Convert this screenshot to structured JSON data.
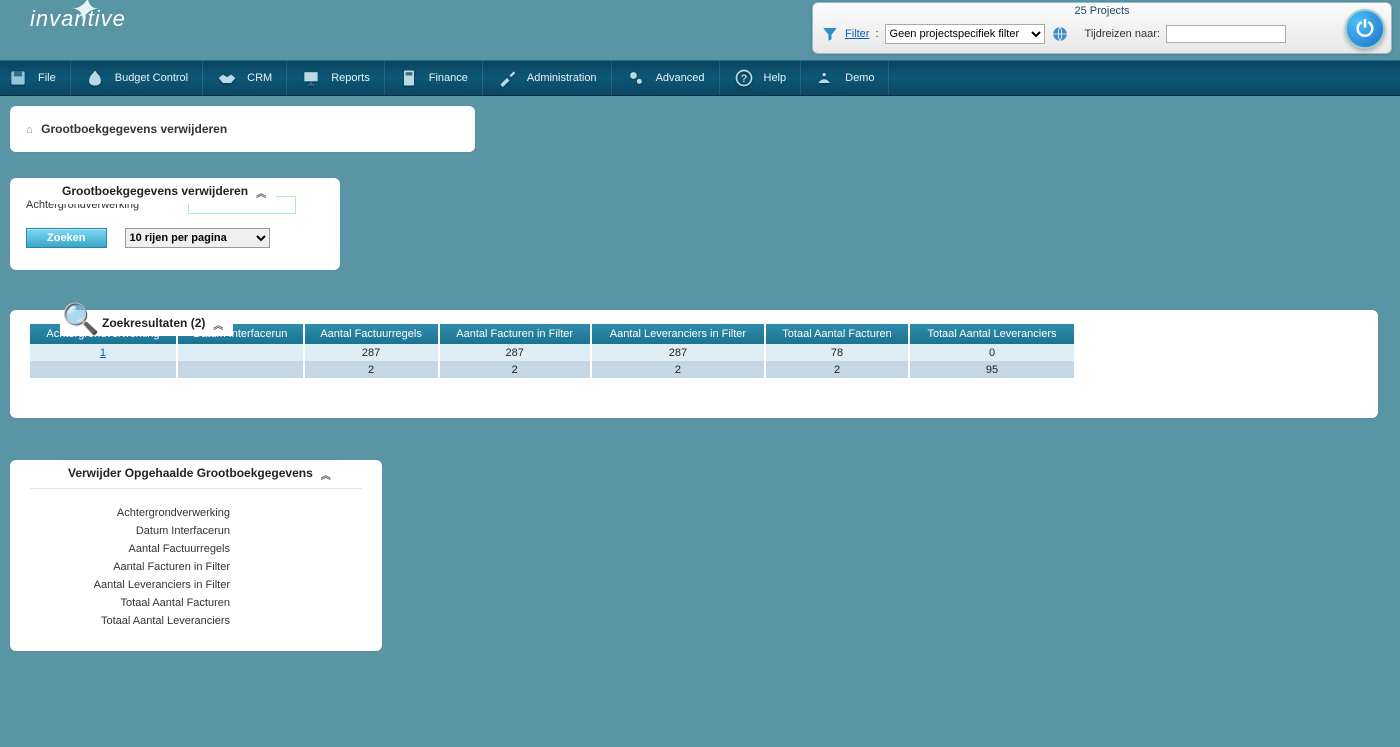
{
  "header": {
    "logo_text": "invantive",
    "projects_title": "25 Projects",
    "filter_label": "Filter",
    "filter_selected": "Geen projectspecifiek filter",
    "tijd_label": "Tijdreizen naar:",
    "tijd_value": ""
  },
  "nav": {
    "items": [
      {
        "label": "File"
      },
      {
        "label": "Budget Control"
      },
      {
        "label": "CRM"
      },
      {
        "label": "Reports"
      },
      {
        "label": "Finance"
      },
      {
        "label": "Administration"
      },
      {
        "label": "Advanced"
      },
      {
        "label": "Help"
      },
      {
        "label": "Demo"
      }
    ]
  },
  "breadcrumb": {
    "title": "Grootboekgegevens verwijderen"
  },
  "search_panel": {
    "title": "Grootboekgegevens verwijderen",
    "field_label": "Achtergrondverwerking",
    "field_value": "",
    "zoeken_label": "Zoeken",
    "rows_selected": "10 rijen per pagina"
  },
  "results_panel": {
    "title": "Zoekresultaten (2)",
    "columns": [
      "Achtergrondverwerking",
      "Datum Interfacerun",
      "Aantal Factuurregels",
      "Aantal Facturen in Filter",
      "Aantal Leveranciers in Filter",
      "Totaal Aantal Facturen",
      "Totaal Aantal Leveranciers"
    ],
    "rows": [
      {
        "c0": "1",
        "c1": "",
        "c2": "287",
        "c3": "287",
        "c4": "287",
        "c5": "78",
        "c6": "0"
      },
      {
        "c0": "",
        "c1": "",
        "c2": "2",
        "c3": "2",
        "c4": "2",
        "c5": "2",
        "c6": "95"
      }
    ]
  },
  "detail_panel": {
    "title": "Verwijder Opgehaalde Grootboekgegevens",
    "fields": [
      "Achtergrondverwerking",
      "Datum Interfacerun",
      "Aantal Factuurregels",
      "Aantal Facturen in Filter",
      "Aantal Leveranciers in Filter",
      "Totaal Aantal Facturen",
      "Totaal Aantal Leveranciers"
    ]
  }
}
